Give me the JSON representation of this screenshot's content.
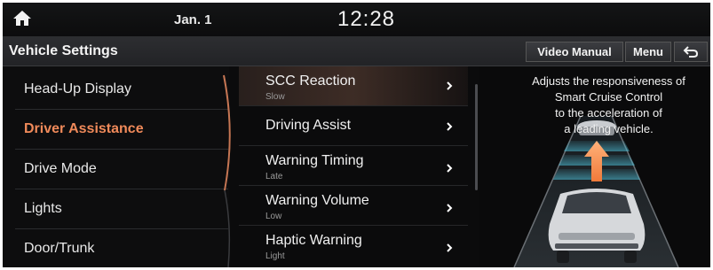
{
  "status": {
    "home_icon": "home-icon",
    "date": "Jan. 1",
    "time": "12:28"
  },
  "title_bar": {
    "title": "Vehicle Settings",
    "video_manual": "Video Manual",
    "menu": "Menu",
    "back_icon": "back-arrow-icon"
  },
  "left_menu": {
    "items": [
      {
        "label": "Head-Up Display"
      },
      {
        "label": "Driver Assistance",
        "active": true
      },
      {
        "label": "Drive Mode"
      },
      {
        "label": "Lights"
      },
      {
        "label": "Door/Trunk"
      }
    ]
  },
  "sub_menu": {
    "items": [
      {
        "label": "SCC Reaction",
        "value": "Slow",
        "selected": true
      },
      {
        "label": "Driving Assist",
        "value": ""
      },
      {
        "label": "Warning Timing",
        "value": "Late"
      },
      {
        "label": "Warning Volume",
        "value": "Low"
      },
      {
        "label": "Haptic Warning",
        "value": "Light"
      }
    ]
  },
  "info": {
    "lines": [
      "Adjusts the responsiveness of",
      "Smart Cruise Control",
      "to the acceleration of",
      "a leading vehicle."
    ]
  },
  "colors": {
    "active": "#f08a5a",
    "background": "#0b0b0c",
    "lane_glow": "#4fc3dc",
    "arrow": "#f07a3a"
  }
}
